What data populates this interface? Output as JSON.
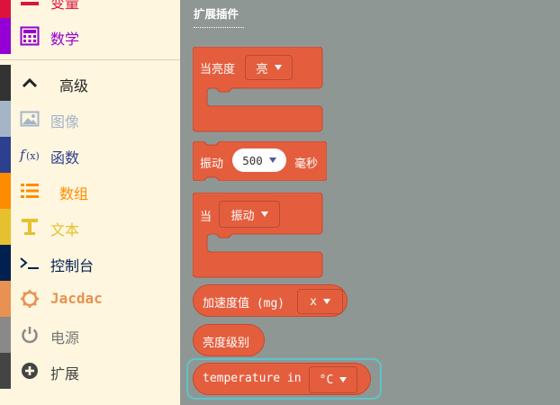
{
  "sidebar": {
    "items": [
      {
        "label": "变量",
        "color": "#dc143c",
        "icon": "variables-icon"
      },
      {
        "label": "数学",
        "color": "#9400d3",
        "icon": "math-icon"
      },
      {
        "label": "高级",
        "color": "#333333",
        "icon": "chevron-up-icon"
      },
      {
        "label": "图像",
        "color": "#a5b5c8",
        "icon": "image-icon"
      },
      {
        "label": "函数",
        "color": "#2d3f8f",
        "icon": "function-icon"
      },
      {
        "label": "数组",
        "color": "#ff8c00",
        "icon": "array-icon"
      },
      {
        "label": "文本",
        "color": "#e5c130",
        "icon": "text-icon"
      },
      {
        "label": "控制台",
        "color": "#002050",
        "icon": "console-icon"
      },
      {
        "label": "Jacdac",
        "color": "#e79251",
        "icon": "jacdac-icon"
      },
      {
        "label": "电源",
        "color": "#898989",
        "icon": "power-icon"
      },
      {
        "label": "扩展",
        "color": "#444444",
        "icon": "extensions-icon"
      }
    ]
  },
  "workspace": {
    "heading": "扩展插件",
    "blocks": {
      "brightness_event": {
        "label": "当亮度",
        "option": "亮"
      },
      "vibrate": {
        "label": "振动",
        "value": "500",
        "unit": "毫秒"
      },
      "vibration_event": {
        "label": "当",
        "option": "振动"
      },
      "acceleration": {
        "label": "加速度值 (mg)",
        "option": "x"
      },
      "brightness_level": {
        "label": "亮度级别"
      },
      "temperature": {
        "label": "temperature in",
        "option": "°C"
      }
    },
    "block_color": "#e45e3e",
    "highlight_color": "#5bc5c8"
  }
}
